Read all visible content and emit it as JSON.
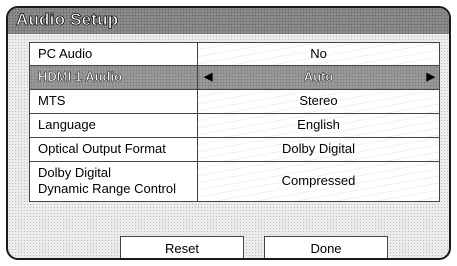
{
  "dialog": {
    "title": "Audio Setup"
  },
  "settings": [
    {
      "label": "PC Audio",
      "value": "No"
    },
    {
      "label": "HDMI 1 Audio",
      "value": "Auto",
      "selected": true
    },
    {
      "label": "MTS",
      "value": "Stereo"
    },
    {
      "label": "Language",
      "value": "English"
    },
    {
      "label": "Optical Output Format",
      "value": "Dolby Digital"
    },
    {
      "label_line1": "Dolby Digital",
      "label_line2": "Dynamic Range Control",
      "value": "Compressed"
    }
  ],
  "buttons": {
    "reset": "Reset",
    "done": "Done"
  },
  "icons": {
    "left_arrow": "triangle-left-icon",
    "right_arrow": "triangle-right-icon"
  }
}
